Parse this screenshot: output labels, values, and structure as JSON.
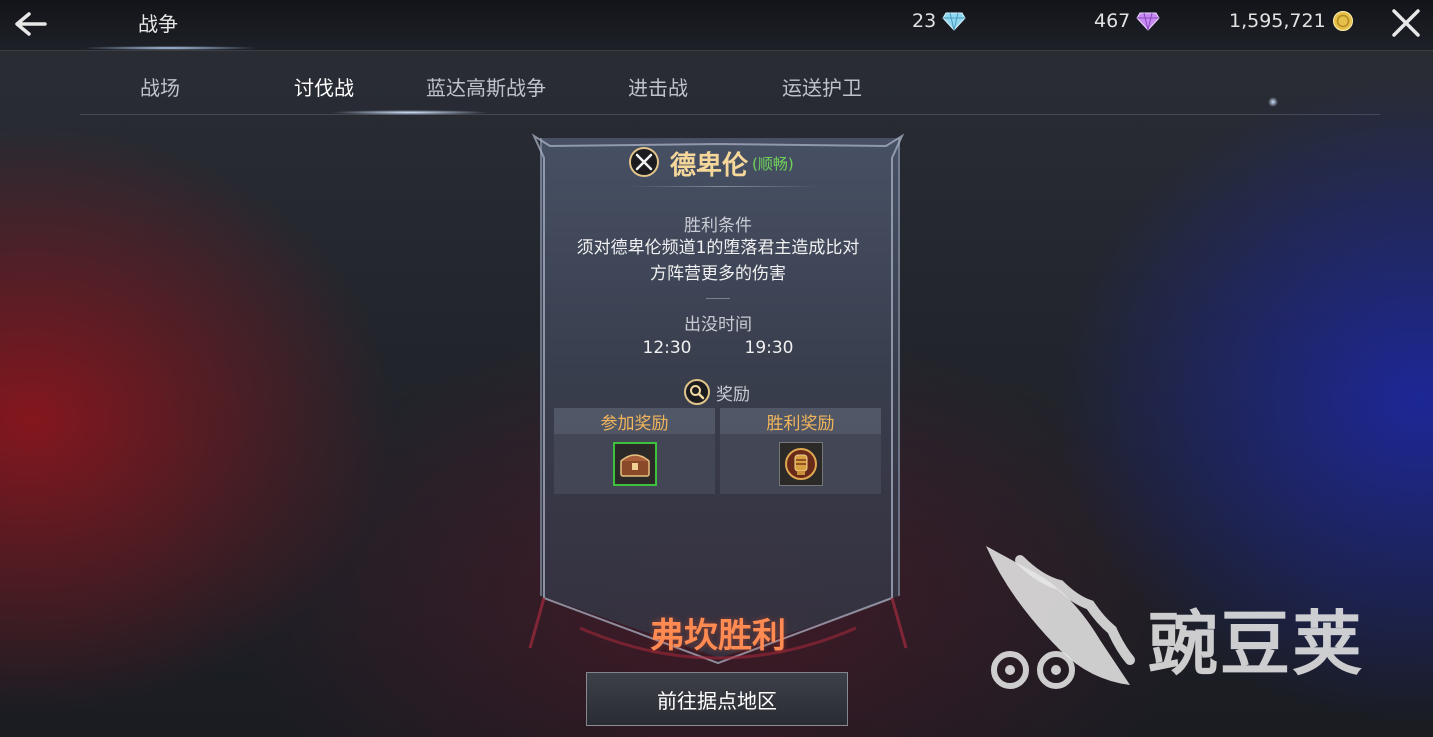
{
  "header": {
    "title": "战争",
    "currencies": [
      {
        "value": "23",
        "icon": "blue-gem-icon",
        "color": "#8fd8f0"
      },
      {
        "value": "467",
        "icon": "purple-gem-icon",
        "color": "#c68af2"
      },
      {
        "value": "1,595,721",
        "icon": "gold-coin-icon",
        "color": "#e6c04a"
      }
    ]
  },
  "tabs": [
    {
      "label": "战场"
    },
    {
      "label": "讨伐战",
      "active": true
    },
    {
      "label": "蓝达高斯战争"
    },
    {
      "label": "进击战"
    },
    {
      "label": "运送护卫"
    }
  ],
  "card": {
    "name": "德卑伦",
    "status": "(顺畅)",
    "victory_condition_label": "胜利条件",
    "victory_condition_line1": "须对德卑伦频道1的堕落君主造成比对",
    "victory_condition_line2": "方阵营更多的伤害",
    "appear_time_label": "出没时间",
    "times": [
      "12:30",
      "19:30"
    ],
    "reward_label": "奖励",
    "reward_columns": [
      "参加奖励",
      "胜利奖励"
    ],
    "result": "弗坎胜利",
    "goto_button": "前往据点地区"
  },
  "watermark": {
    "text": "豌豆荚"
  },
  "colors": {
    "accent_gold": "#f5d79a",
    "status_green": "#6fd35a",
    "reward_orange": "#f2b55b",
    "result_orange": "#ff8a52"
  }
}
